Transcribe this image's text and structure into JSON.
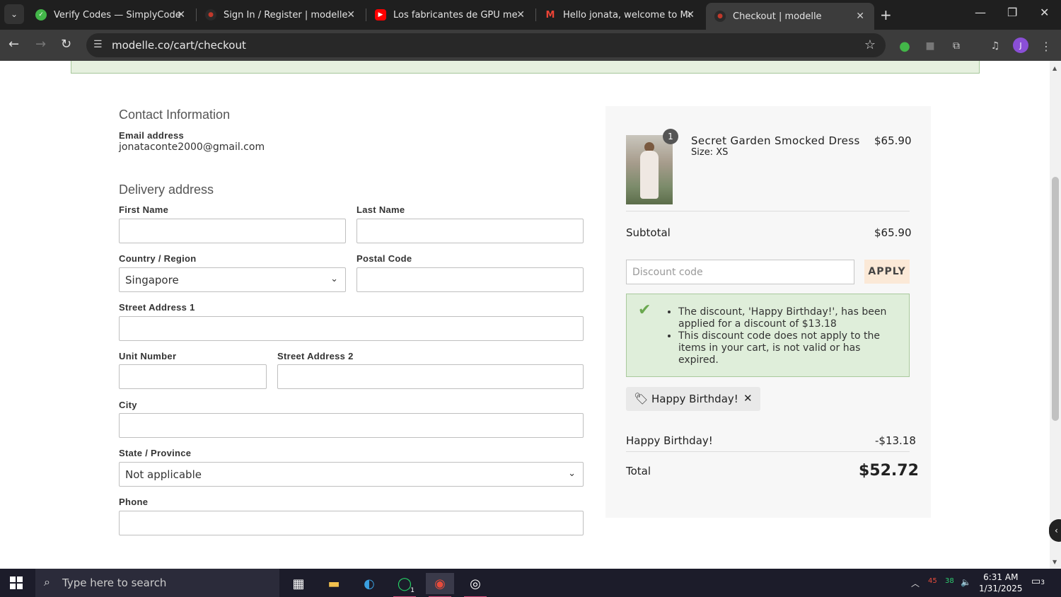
{
  "browser": {
    "tabs": [
      {
        "title": "Verify Codes — SimplyCodes",
        "fav_color": "#43b649"
      },
      {
        "title": "Sign In / Register | modelle",
        "fav_color": "#c0392b"
      },
      {
        "title": "Los fabricantes de GPU me OD",
        "fav_color": "#ff0000"
      },
      {
        "title": "Hello jonata, welcome to Mode",
        "fav_color": "#ea4335"
      },
      {
        "title": "Checkout | modelle",
        "fav_color": "#c0392b"
      }
    ],
    "url": "modelle.co/cart/checkout",
    "profile_initial": "J"
  },
  "contact": {
    "heading": "Contact Information",
    "email_label": "Email address",
    "email_value": "jonataconte2000@gmail.com"
  },
  "delivery": {
    "heading": "Delivery address",
    "first_name_label": "First Name",
    "last_name_label": "Last Name",
    "country_label": "Country / Region",
    "country_value": "Singapore",
    "postal_label": "Postal Code",
    "street1_label": "Street Address 1",
    "unit_label": "Unit Number",
    "street2_label": "Street Address 2",
    "city_label": "City",
    "state_label": "State / Province",
    "state_value": "Not applicable",
    "phone_label": "Phone"
  },
  "summary": {
    "item_name": "Secret Garden Smocked Dress",
    "item_size": "Size:  XS",
    "item_price": "$65.90",
    "item_qty": "1",
    "subtotal_label": "Subtotal",
    "subtotal_value": "$65.90",
    "discount_placeholder": "Discount code",
    "apply_label": "APPLY",
    "alert_messages": [
      "The discount, 'Happy Birthday!', has been applied for a discount of $13.18",
      "This discount code does not apply to the items in your cart, is not valid or has expired."
    ],
    "tag_label": "Happy Birthday!",
    "discount_line_label": "Happy Birthday!",
    "discount_line_value": "-$13.18",
    "total_label": "Total",
    "total_value": "$52.72"
  },
  "taskbar": {
    "search_placeholder": "Type here to search",
    "whatsapp_badge": "1",
    "tray_a": "45",
    "tray_b": "38",
    "time": "6:31 AM",
    "date": "1/31/2025",
    "notification_count": "3"
  }
}
